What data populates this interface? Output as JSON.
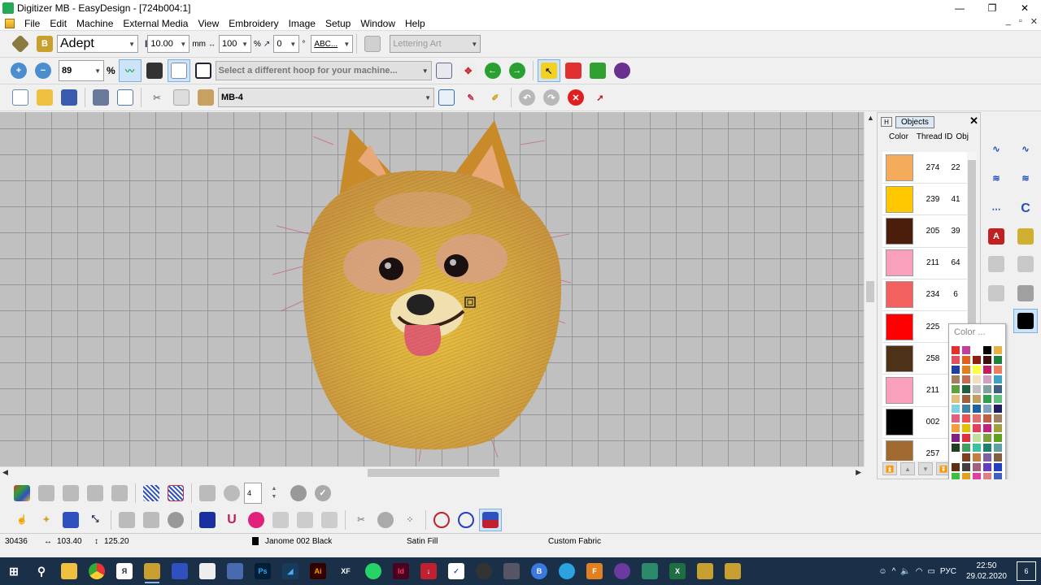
{
  "window": {
    "title": "Digitizer MB - EasyDesign - [724b004:1]",
    "controls": [
      "—",
      "❐",
      "✕"
    ],
    "mdi_controls": [
      "_",
      "▫",
      "✕"
    ]
  },
  "menu": [
    "File",
    "Edit",
    "Machine",
    "External Media",
    "View",
    "Embroidery",
    "Image",
    "Setup",
    "Window",
    "Help"
  ],
  "toolbar1": {
    "font_name": "Adept",
    "height_value": "10.00",
    "height_unit": "mm",
    "width_value": "100",
    "width_unit": "%",
    "angle_value": "0",
    "angle_unit": "°",
    "text_style": "ABC...",
    "lettering_art": "Lettering Art"
  },
  "toolbar2": {
    "zoom_value": "89",
    "zoom_unit": "%",
    "hoop_placeholder": "Select a different hoop for your machine..."
  },
  "toolbar3": {
    "machine": "MB-4"
  },
  "objects_panel": {
    "tab_label": "Objects",
    "pin_label": "H",
    "close_label": "✕",
    "col_color": "Color",
    "col_thread": "Thread ID",
    "col_obj": "Obj",
    "rows": [
      {
        "color": "#f4ac5a",
        "thread": "274",
        "count": "22"
      },
      {
        "color": "#ffc800",
        "thread": "239",
        "count": "41"
      },
      {
        "color": "#4a1e0a",
        "thread": "205",
        "count": "39"
      },
      {
        "color": "#f9a0bc",
        "thread": "211",
        "count": "64"
      },
      {
        "color": "#f26060",
        "thread": "234",
        "count": "6"
      },
      {
        "color": "#ff0000",
        "thread": "225",
        "count": ""
      },
      {
        "color": "#4e3218",
        "thread": "258",
        "count": ""
      },
      {
        "color": "#f9a0bc",
        "thread": "211",
        "count": ""
      },
      {
        "color": "#000000",
        "thread": "002",
        "count": ""
      },
      {
        "color": "#a06a30",
        "thread": "257",
        "count": ""
      }
    ]
  },
  "color_popup": {
    "label": "Color ...",
    "swatches": [
      "#e03030",
      "#c040a0",
      "#ffffff",
      "#000000",
      "#e8b040",
      "#e05060",
      "#e06020",
      "#8b2010",
      "#401010",
      "#208040",
      "#2040a0",
      "#e08020",
      "#ffff40",
      "#c02060",
      "#e88060",
      "#a08060",
      "#c07050",
      "#f0e0c0",
      "#d0a0c0",
      "#40a0c0",
      "#60a040",
      "#206040",
      "#c0c0c0",
      "#80a0a0",
      "#406080",
      "#e0c080",
      "#a06040",
      "#c0a060",
      "#30a050",
      "#60c080",
      "#80d0e0",
      "#4080a0",
      "#2060a0",
      "#80a0c0",
      "#202060",
      "#e06080",
      "#f05050",
      "#e07070",
      "#c06040",
      "#a08060",
      "#f0a040",
      "#e0c000",
      "#e04060",
      "#c02080",
      "#a0a040",
      "#802080",
      "#e03040",
      "#c0e0a0",
      "#80a040",
      "#60a020",
      "#204020",
      "#40a060",
      "#40c0a0",
      "#208070",
      "#60a0a0",
      "#ffffff",
      "#804020",
      "#c08040",
      "#8060a0",
      "#806040",
      "#603010",
      "#404040",
      "#a06080",
      "#6040c0",
      "#2040c0",
      "#40c040",
      "#e0a020",
      "#e040a0",
      "#e08080",
      "#4060c0",
      "#40a040",
      "#c0a000",
      "#e0c040",
      "#e0e040",
      "#a0a000",
      "#e08000",
      "#f0a000",
      "#e0c000"
    ]
  },
  "status": {
    "stitches": "30436",
    "width": "103.40",
    "height": "125.20",
    "thread": "Janome 002 Black",
    "stitch_type": "Satin Fill",
    "fabric": "Custom Fabric"
  },
  "bottom_spinner": "4",
  "taskbar": {
    "tray_lang": "РУС",
    "time": "22:50",
    "date": "29.02.2020",
    "notifications": "6"
  }
}
